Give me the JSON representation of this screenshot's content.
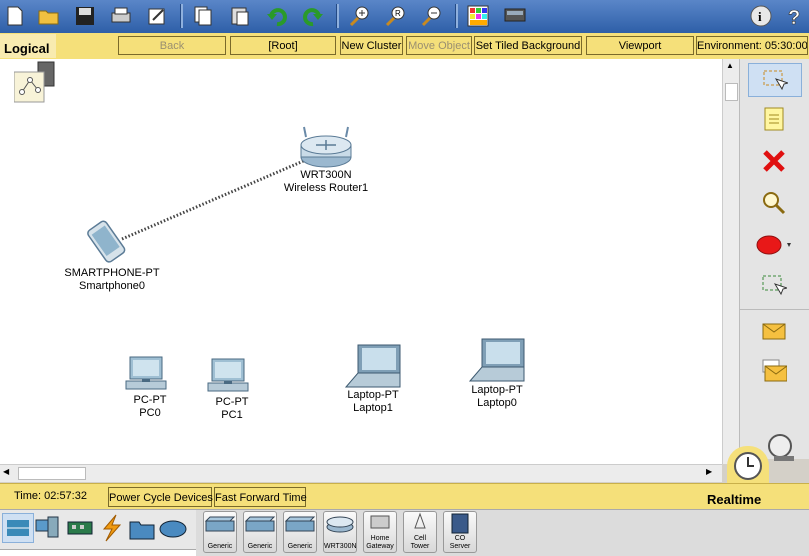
{
  "toolbar": {
    "icons": [
      "new-file-icon",
      "open-folder-icon",
      "save-icon",
      "print-icon",
      "activity-wizard-icon",
      "copy-icon",
      "paste-icon",
      "undo-icon",
      "redo-icon",
      "zoom-in-icon",
      "zoom-reset-icon",
      "zoom-out-icon",
      "palette-icon",
      "custom-device-icon",
      "info-icon",
      "help-icon"
    ]
  },
  "topbar": {
    "logical": "Logical",
    "back": "Back",
    "root": "[Root]",
    "new_cluster": "New Cluster",
    "move_object": "Move Object",
    "set_tiled_background": "Set Tiled Background",
    "viewport": "Viewport",
    "environment": "Environment: 05:30:00"
  },
  "devices": {
    "router": {
      "model": "WRT300N",
      "name": "Wireless Router1"
    },
    "smartphone": {
      "model": "SMARTPHONE-PT",
      "name": "Smartphone0"
    },
    "pc0": {
      "model": "PC-PT",
      "name": "PC0"
    },
    "pc1": {
      "model": "PC-PT",
      "name": "PC1"
    },
    "laptop1": {
      "model": "Laptop-PT",
      "name": "Laptop1"
    },
    "laptop0": {
      "model": "Laptop-PT",
      "name": "Laptop0"
    }
  },
  "statusbar": {
    "time": "Time: 02:57:32",
    "power_cycle": "Power Cycle Devices",
    "fast_forward": "Fast Forward Time",
    "realtime": "Realtime"
  },
  "device_palette": [
    "Generic",
    "Generic",
    "Generic",
    "WRT300N",
    "Home Gateway",
    "Cell Tower",
    "CO Server"
  ],
  "colors": {
    "toolbar": "#3a6cb8",
    "yellow_bar": "#f5e07a",
    "canvas": "#ffffff"
  }
}
